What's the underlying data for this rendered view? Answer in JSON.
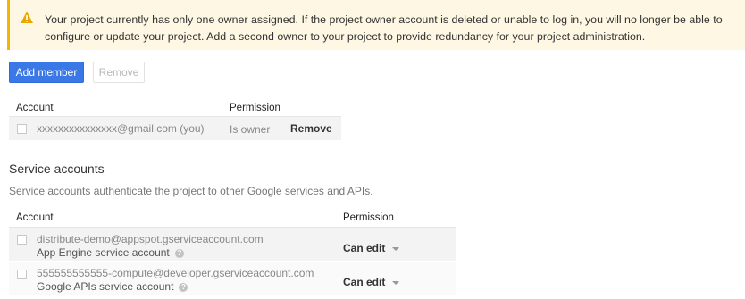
{
  "warning": {
    "icon": "warning-icon",
    "line1": "Your project currently has only one owner assigned. If the project owner account is deleted or unable to log in, you will no longer be able to",
    "line2": "configure or update your project. Add a second owner to your project to provide redundancy for your project administration."
  },
  "toolbar": {
    "add_member_label": "Add member",
    "remove_label": "Remove"
  },
  "members_table": {
    "headers": {
      "account": "Account",
      "permission": "Permission"
    },
    "rows": [
      {
        "account": "xxxxxxxxxxxxxxx@gmail.com (you)",
        "permission": "Is owner",
        "action": "Remove"
      }
    ]
  },
  "service_accounts": {
    "title": "Service accounts",
    "description": "Service accounts authenticate the project to other Google services and APIs.",
    "headers": {
      "account": "Account",
      "permission": "Permission"
    },
    "rows": [
      {
        "account": "distribute-demo@appspot.gserviceaccount.com",
        "subtitle": "App Engine service account",
        "permission": "Can edit"
      },
      {
        "account": "555555555555-compute@developer.gserviceaccount.com",
        "subtitle": "Google APIs service account",
        "permission": "Can edit"
      }
    ]
  },
  "colors": {
    "primary": "#3b78e7",
    "warning_accent": "#f4b400",
    "warning_bg": "#fdf7e3"
  }
}
